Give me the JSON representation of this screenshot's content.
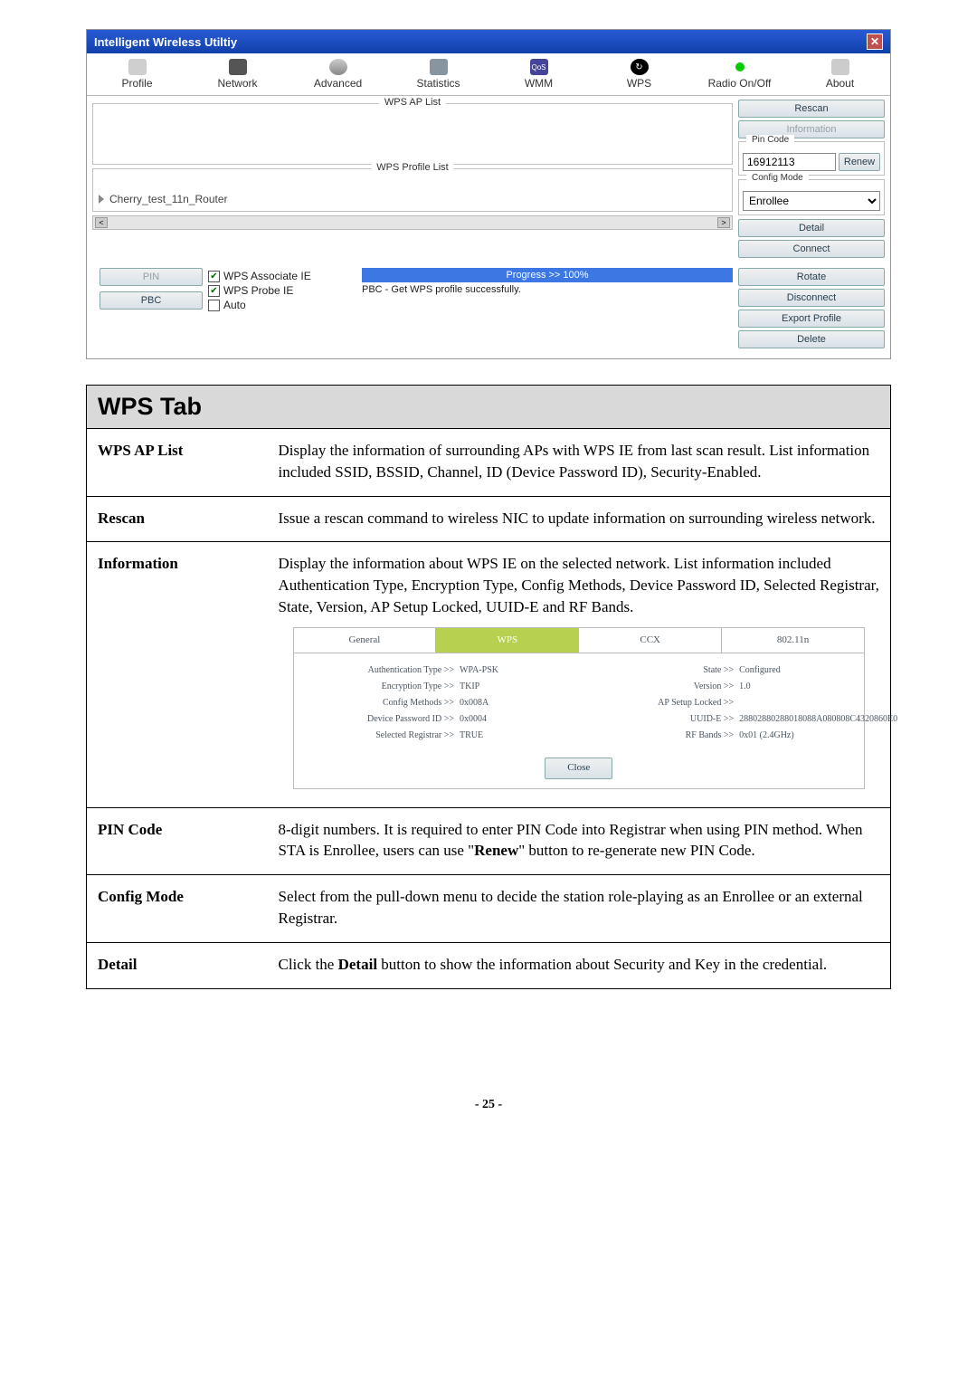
{
  "utility": {
    "title": "Intelligent Wireless Utiltiy",
    "nav": [
      "Profile",
      "Network",
      "Advanced",
      "Statistics",
      "WMM",
      "WPS",
      "Radio On/Off",
      "About"
    ],
    "ap_list_title": "WPS AP List",
    "profile_list_title": "WPS Profile List",
    "profile_entry": "Cherry_test_11n_Router",
    "side": {
      "rescan": "Rescan",
      "information": "Information",
      "pin_code_legend": "Pin Code",
      "pin_value": "16912113",
      "renew": "Renew",
      "config_mode_legend": "Config Mode",
      "config_mode_value": "Enrollee",
      "detail": "Detail",
      "connect": "Connect",
      "rotate": "Rotate",
      "disconnect": "Disconnect",
      "export": "Export Profile",
      "delete": "Delete"
    },
    "footer": {
      "pin": "PIN",
      "pbc": "PBC",
      "assoc": "WPS Associate IE",
      "probe": "WPS Probe IE",
      "auto": "Auto",
      "progress": "Progress >> 100%",
      "pbc_msg": "PBC - Get WPS profile successfully."
    }
  },
  "table": {
    "heading": "WPS Tab",
    "rows": [
      {
        "label": "WPS AP List",
        "text": "Display the information of surrounding APs with WPS IE from last scan result. List information included SSID, BSSID, Channel, ID (Device Password ID), Security-Enabled."
      },
      {
        "label": "Rescan",
        "text": "Issue a rescan command to wireless NIC to update information on surrounding wireless network."
      },
      {
        "label": "Information",
        "text": "Display the information about WPS IE on the selected network. List information included Authentication Type, Encryption Type, Config Methods, Device Password ID, Selected Registrar, State, Version, AP Setup Locked, UUID-E and RF Bands."
      },
      {
        "label": "PIN Code",
        "text_before": "8-digit numbers. It is required to enter PIN Code into Registrar when using PIN method. When STA is Enrollee, users can use \"",
        "bold": "Renew",
        "text_after": "\" button to re-generate new PIN Code."
      },
      {
        "label": "Config Mode",
        "text": "Select from the pull-down menu to decide the station role-playing as an Enrollee or an external Registrar."
      },
      {
        "label": "Detail",
        "text_before": "Click the ",
        "bold": "Detail",
        "text_after": " button to show the information about Security and Key in the credential."
      }
    ],
    "inner": {
      "tabs": [
        "General",
        "WPS",
        "CCX",
        "802.11n"
      ],
      "left": [
        {
          "l": "Authentication Type >>",
          "v": "WPA-PSK"
        },
        {
          "l": "Encryption Type >>",
          "v": "TKIP"
        },
        {
          "l": "Config Methods >>",
          "v": "0x008A"
        },
        {
          "l": "Device Password ID >>",
          "v": "0x0004"
        },
        {
          "l": "Selected Registrar >>",
          "v": "TRUE"
        }
      ],
      "right": [
        {
          "l": "State >>",
          "v": "Configured"
        },
        {
          "l": "Version >>",
          "v": "1.0"
        },
        {
          "l": "AP Setup Locked >>",
          "v": ""
        },
        {
          "l": "UUID-E >>",
          "v": "28802880288018088A080808C4320860E0"
        },
        {
          "l": "RF Bands >>",
          "v": "0x01 (2.4GHz)"
        }
      ],
      "close": "Close"
    }
  },
  "page_number": "- 25 -"
}
